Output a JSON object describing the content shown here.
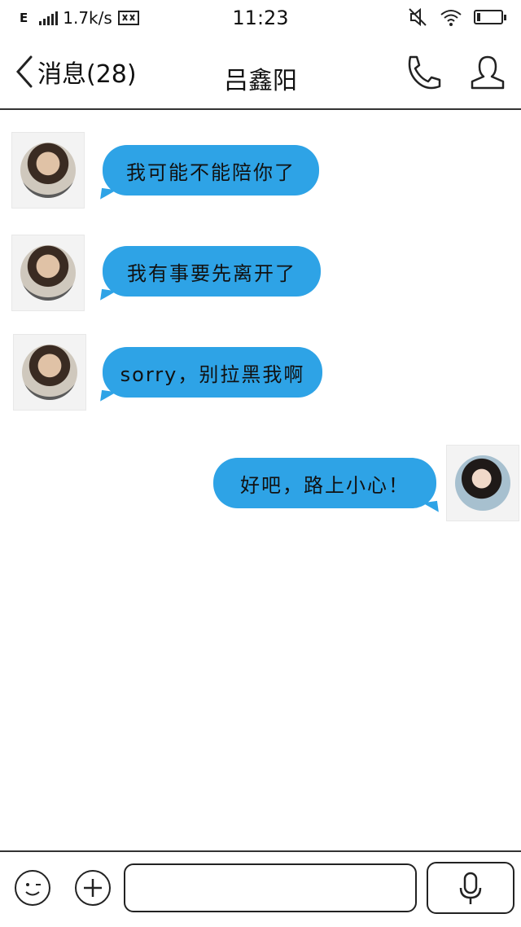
{
  "status_bar": {
    "network": "E",
    "speed": "1.7k/s",
    "time": "11:23"
  },
  "header": {
    "back_label": "消息(28)",
    "title": "吕鑫阳"
  },
  "messages": [
    {
      "side": "left",
      "text": "我可能不能陪你了"
    },
    {
      "side": "left",
      "text": "我有事要先离开了"
    },
    {
      "side": "left",
      "text": "sorry，别拉黑我啊"
    },
    {
      "side": "right",
      "text": "好吧，路上小心！"
    }
  ],
  "input": {
    "placeholder": ""
  },
  "colors": {
    "bubble": "#2ea3e6",
    "background": "#ffffff",
    "ink": "#222222"
  },
  "icons": [
    "signal-icon",
    "hd-icon",
    "mute-icon",
    "wifi-icon",
    "battery-icon",
    "back-chevron-icon",
    "phone-icon",
    "profile-icon",
    "emoji-icon",
    "plus-icon",
    "mic-icon"
  ]
}
